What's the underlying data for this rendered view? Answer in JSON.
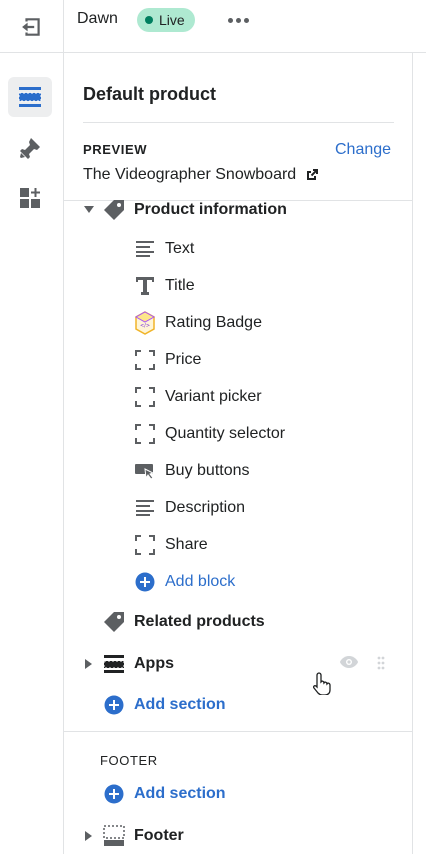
{
  "topbar": {
    "theme_name": "Dawn",
    "status_badge": "Live",
    "exit_icon": "exit-icon",
    "more_icon": "more-horizontal-icon"
  },
  "rail": {
    "items": [
      {
        "icon": "sections-icon",
        "active": true
      },
      {
        "icon": "theme-settings-brush-icon",
        "active": false
      },
      {
        "icon": "app-embeds-icon",
        "active": false
      }
    ]
  },
  "panel": {
    "title": "Default product",
    "preview": {
      "label": "PREVIEW",
      "change_label": "Change",
      "value": "The Videographer Snowboard",
      "external_icon": "external-link-icon"
    },
    "product_information": {
      "label": "Product information",
      "icon": "tag-icon",
      "blocks": [
        {
          "label": "Text",
          "icon": "text-lines-icon"
        },
        {
          "label": "Title",
          "icon": "title-t-icon"
        },
        {
          "label": "Rating Badge",
          "icon": "rating-badge-app-icon"
        },
        {
          "label": "Price",
          "icon": "dashed-box-icon"
        },
        {
          "label": "Variant picker",
          "icon": "dashed-box-icon"
        },
        {
          "label": "Quantity selector",
          "icon": "dashed-box-icon"
        },
        {
          "label": "Buy buttons",
          "icon": "buy-button-icon"
        },
        {
          "label": "Description",
          "icon": "text-lines-icon"
        },
        {
          "label": "Share",
          "icon": "dashed-box-icon"
        }
      ],
      "add_block_label": "Add block"
    },
    "related_products": {
      "label": "Related products",
      "icon": "tag-icon"
    },
    "apps": {
      "label": "Apps",
      "icon": "section-icon"
    },
    "add_section_label": "Add section",
    "footer_group": {
      "label": "FOOTER",
      "add_section_label": "Add section",
      "footer_item": {
        "label": "Footer",
        "icon": "section-icon"
      }
    }
  },
  "colors": {
    "accent": "#2c6ecb",
    "badge_bg": "#aee9d1",
    "badge_dot": "#007f5f",
    "icon_gray": "#5c5f62",
    "border": "#e1e3e5"
  }
}
